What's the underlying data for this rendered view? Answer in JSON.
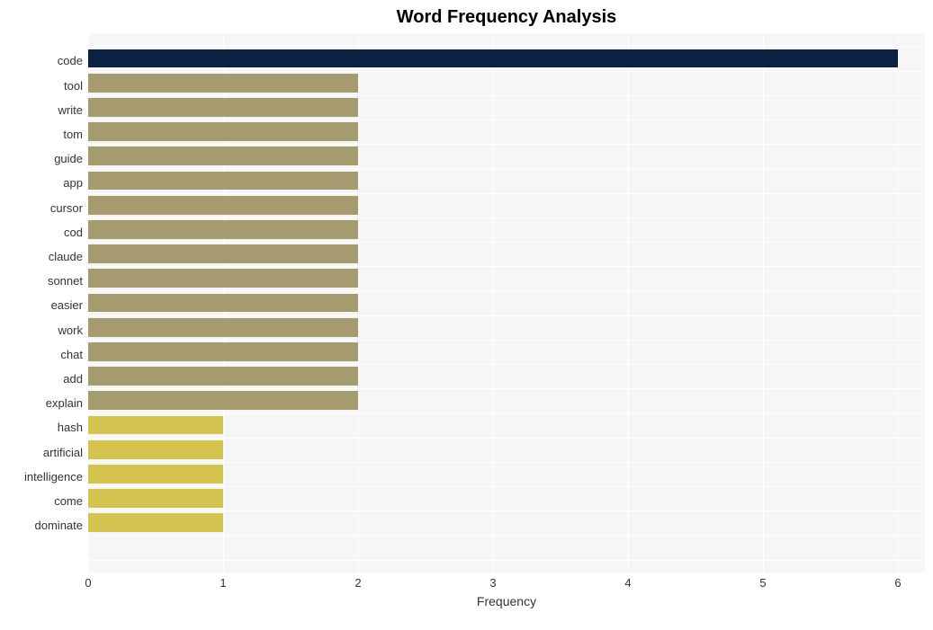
{
  "chart_data": {
    "type": "bar",
    "title": "Word Frequency Analysis",
    "xlabel": "Frequency",
    "ylabel": "",
    "xlim": [
      0,
      6.2
    ],
    "x_ticks": [
      0,
      1,
      2,
      3,
      4,
      5,
      6
    ],
    "categories": [
      "code",
      "tool",
      "write",
      "tom",
      "guide",
      "app",
      "cursor",
      "cod",
      "claude",
      "sonnet",
      "easier",
      "work",
      "chat",
      "add",
      "explain",
      "hash",
      "artificial",
      "intelligence",
      "come",
      "dominate"
    ],
    "values": [
      6,
      2,
      2,
      2,
      2,
      2,
      2,
      2,
      2,
      2,
      2,
      2,
      2,
      2,
      2,
      1,
      1,
      1,
      1,
      1
    ],
    "colors": [
      "#0a2342",
      "#a59b6f",
      "#a59b6f",
      "#a59b6f",
      "#a59b6f",
      "#a59b6f",
      "#a59b6f",
      "#a59b6f",
      "#a59b6f",
      "#a59b6f",
      "#a59b6f",
      "#a59b6f",
      "#a59b6f",
      "#a59b6f",
      "#a59b6f",
      "#d4c34e",
      "#d4c34e",
      "#d4c34e",
      "#d4c34e",
      "#d4c34e"
    ]
  }
}
